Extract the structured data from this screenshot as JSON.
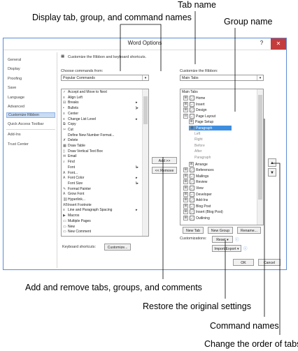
{
  "callouts": {
    "tab_name": "Tab name",
    "display_tab": "Display tab, group, and command names",
    "group_name": "Group name",
    "add_remove": "Add and remove tabs, groups, and comments",
    "restore": "Restore the original settings",
    "command_names": "Command names",
    "change_order": "Change the order of tabs"
  },
  "dialog": {
    "title": "Word Options",
    "help": "?",
    "close": "✕"
  },
  "nav": {
    "general": "General",
    "display": "Display",
    "proofing": "Proofing",
    "save": "Save",
    "language": "Language",
    "advanced": "Advanced",
    "customize_ribbon": "Customize Ribbon",
    "quick_access": "Quick Access Toolbar",
    "addins": "Add-Ins",
    "trust_center": "Trust Center"
  },
  "main": {
    "header": "Customize the Ribbon and keyboard shortcuts.",
    "choose_label": "Choose commands from:",
    "choose_value": "Popular Commands",
    "customize_label": "Customize the Ribbon:",
    "customize_value": "Main Tabs",
    "add": "Add >>",
    "remove": "<< Remove",
    "commands": [
      {
        "label": "Accept and Move to Next",
        "icon": "✓"
      },
      {
        "label": "Align Left",
        "icon": "≡"
      },
      {
        "label": "Breaks",
        "icon": "⊟",
        "more": "▸"
      },
      {
        "label": "Bullets",
        "icon": "•",
        "more": "|▸"
      },
      {
        "label": "Center",
        "icon": "≡"
      },
      {
        "label": "Change List Level",
        "icon": "≡",
        "more": "▸"
      },
      {
        "label": "Copy",
        "icon": "⧉"
      },
      {
        "label": "Cut",
        "icon": "✂"
      },
      {
        "label": "Define New Number Format...",
        "icon": ""
      },
      {
        "label": "Delete",
        "icon": "✗"
      },
      {
        "label": "Draw Table",
        "icon": "▦"
      },
      {
        "label": "Draw Vertical Text Box",
        "icon": "▯"
      },
      {
        "label": "Email",
        "icon": "✉"
      },
      {
        "label": "Find",
        "icon": "⌕"
      },
      {
        "label": "Font",
        "icon": "",
        "more": "I▸"
      },
      {
        "label": "Font...",
        "icon": "A"
      },
      {
        "label": "Font Color",
        "icon": "A",
        "more": "▸"
      },
      {
        "label": "Font Size",
        "icon": "",
        "more": "I▸"
      },
      {
        "label": "Format Painter",
        "icon": "✎"
      },
      {
        "label": "Grow Font",
        "icon": "A"
      },
      {
        "label": "Hyperlink...",
        "icon": "⛓"
      },
      {
        "label": "Insert Footnote",
        "icon": "AB"
      },
      {
        "label": "Line and Paragraph Spacing",
        "icon": "≡",
        "more": "▸"
      },
      {
        "label": "Macros",
        "icon": "▶"
      },
      {
        "label": "Multiple Pages",
        "icon": "▭"
      },
      {
        "label": "New",
        "icon": "▭"
      },
      {
        "label": "New Comment",
        "icon": "▭"
      }
    ],
    "tree_header": "Main Tabs",
    "tabs_tree": [
      {
        "label": "Home",
        "level": 0,
        "expander": "⊞",
        "check": true
      },
      {
        "label": "Insert",
        "level": 0,
        "expander": "⊞",
        "check": true
      },
      {
        "label": "Design",
        "level": 0,
        "expander": "⊞",
        "check": true
      },
      {
        "label": "Page Layout",
        "level": 0,
        "expander": "⊟",
        "check": true
      },
      {
        "label": "Page Setup",
        "level": 1,
        "expander": "⊞"
      },
      {
        "label": "Paragraph",
        "level": 1,
        "expander": "⊟",
        "selected": true
      },
      {
        "label": "Left",
        "level": 2,
        "grey": true
      },
      {
        "label": "Right",
        "level": 2,
        "grey": true
      },
      {
        "label": "Before",
        "level": 2,
        "grey": true
      },
      {
        "label": "After",
        "level": 2,
        "grey": true
      },
      {
        "label": "Paragraph",
        "level": 2,
        "grey": true
      },
      {
        "label": "Arrange",
        "level": 1,
        "expander": "⊞"
      },
      {
        "label": "References",
        "level": 0,
        "expander": "⊞",
        "check": true
      },
      {
        "label": "Mailings",
        "level": 0,
        "expander": "⊞",
        "check": true
      },
      {
        "label": "Review",
        "level": 0,
        "expander": "⊞",
        "check": true
      },
      {
        "label": "View",
        "level": 0,
        "expander": "⊞",
        "check": true
      },
      {
        "label": "Developer",
        "level": 0,
        "expander": "⊞",
        "check": true
      },
      {
        "label": "Add-Ins",
        "level": 0,
        "expander": "⊞",
        "check": true
      },
      {
        "label": "Blog Post",
        "level": 0,
        "expander": "⊞",
        "check": true
      },
      {
        "label": "Insert (Blog Post)",
        "level": 0,
        "expander": "⊞",
        "check": true
      },
      {
        "label": "Outlining",
        "level": 0,
        "expander": "⊞",
        "check": true
      }
    ],
    "new_tab": "New Tab",
    "new_group": "New Group",
    "rename": "Rename...",
    "customizations_label": "Customizations:",
    "reset": "Reset ▾",
    "import_export": "Import/Export ▾",
    "keyboard_label": "Keyboard shortcuts:",
    "customize_btn": "Customize...",
    "ok": "OK",
    "cancel": "Cancel"
  }
}
